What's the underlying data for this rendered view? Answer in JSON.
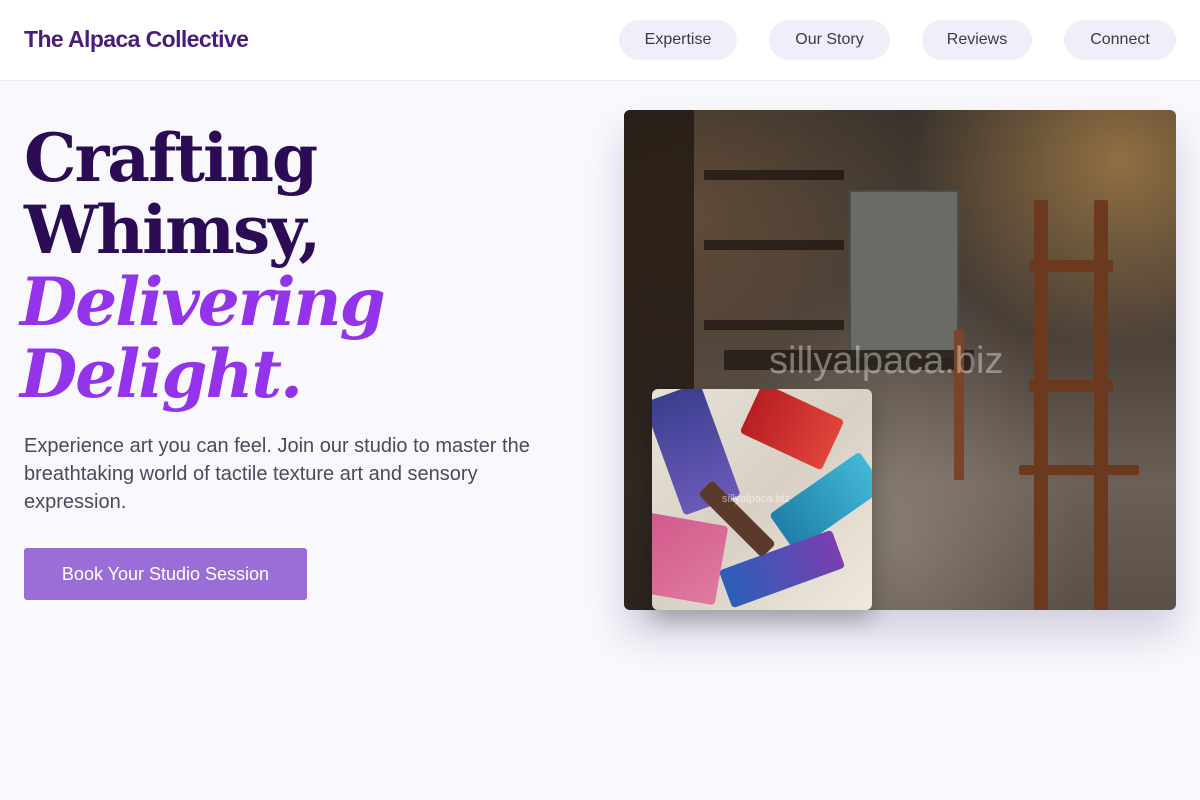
{
  "header": {
    "brand": "The Alpaca Collective",
    "nav": [
      {
        "label": "Expertise"
      },
      {
        "label": "Our Story"
      },
      {
        "label": "Reviews"
      },
      {
        "label": "Connect"
      }
    ]
  },
  "hero": {
    "headline_line1": "Crafting",
    "headline_line2": "Whimsy,",
    "headline_line3": "Delivering",
    "headline_line4": "Delight.",
    "lede": "Experience art you can feel. Join our studio to master the breathtaking world of tactile texture art and sensory expression.",
    "cta": "Book Your Studio Session"
  },
  "images": {
    "main_watermark": "sillyalpaca.biz",
    "inset_watermark": "sillyalpaca.biz"
  },
  "colors": {
    "brand": "#4a1d7a",
    "headline_dark": "#2c0b55",
    "headline_accent": "#9333ea",
    "cta_background": "#9b6dd6",
    "nav_pill": "#f0eef8",
    "page_background": "#f8f8fd"
  }
}
